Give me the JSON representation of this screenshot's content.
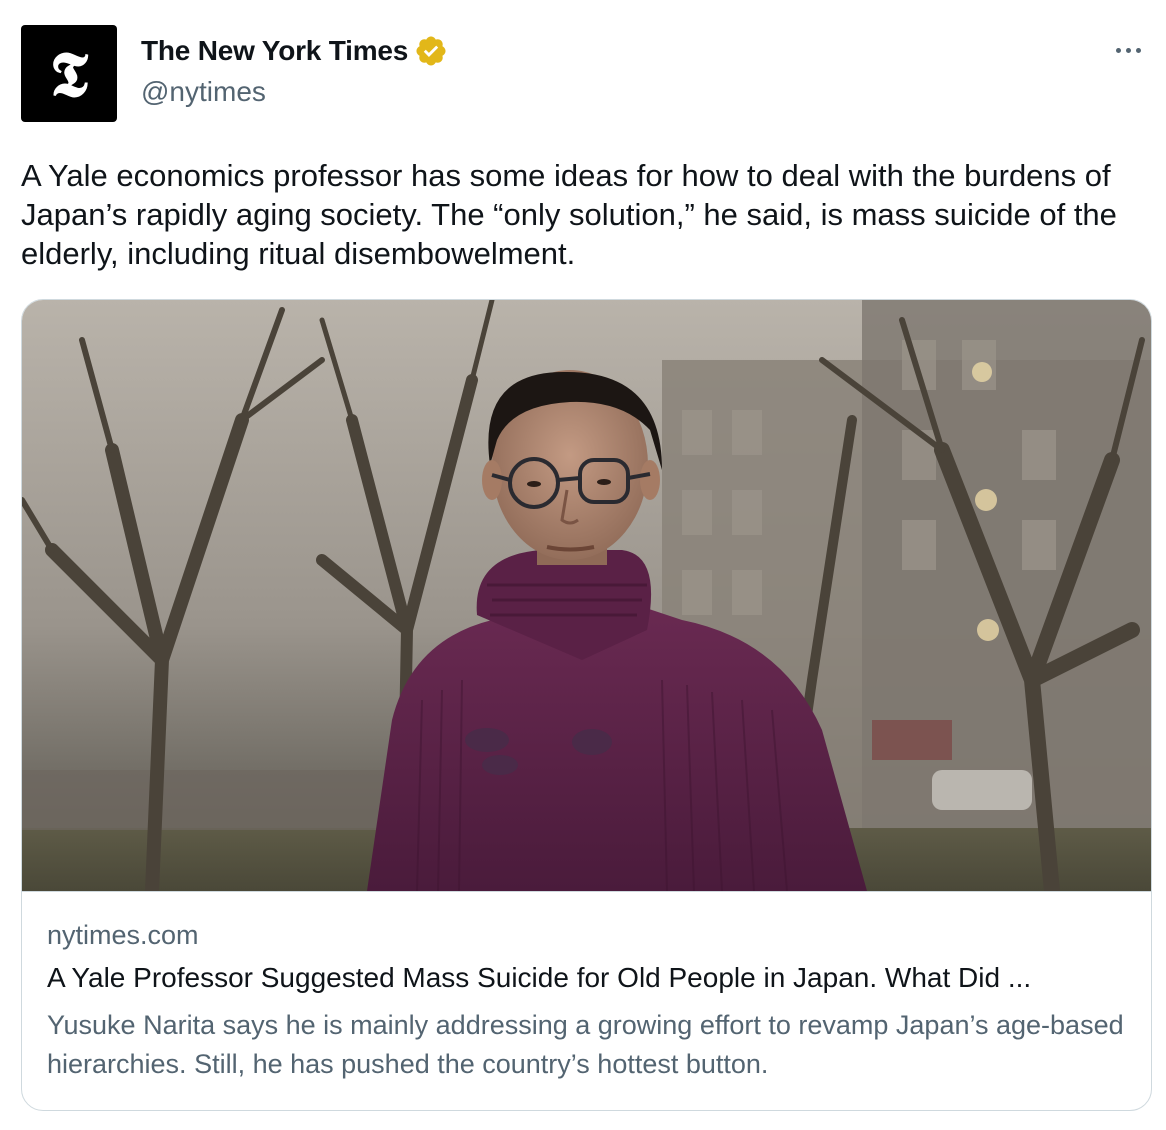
{
  "author": {
    "display_name": "The New York Times",
    "handle": "@nytimes",
    "avatar_glyph": "𝕿",
    "verified": true,
    "verified_color": "#e2b719"
  },
  "more_icon": "more-horizontal-icon",
  "tweet": {
    "text": "A Yale economics professor has some ideas for how to deal with the burdens of Japan’s rapidly aging society. The “only solution,” he said, is mass suicide of the elderly, including ritual disembowelment."
  },
  "card": {
    "domain": "nytimes.com",
    "title": "A Yale Professor Suggested Mass Suicide for Old People in Japan. What Did ...",
    "description": "Yusuke Narita says he is mainly addressing a growing effort to revamp Japan’s age-based hierarchies. Still, he has pushed the country’s hottest button."
  },
  "colors": {
    "text_primary": "#0f1419",
    "text_secondary": "#536471",
    "border": "#cfd9de"
  }
}
